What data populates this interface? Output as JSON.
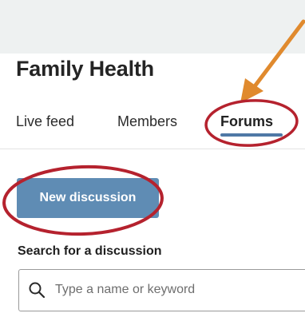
{
  "header": {
    "title": "Family Health"
  },
  "tabs": [
    {
      "label": "Live feed",
      "active": false
    },
    {
      "label": "Members",
      "active": false
    },
    {
      "label": "Forums",
      "active": true
    }
  ],
  "actions": {
    "new_discussion_label": "New discussion"
  },
  "search": {
    "label": "Search for a discussion",
    "placeholder": "Type a name or keyword",
    "value": "",
    "icon": "search-icon"
  },
  "annotations": {
    "arrow_color": "#e08a2e",
    "circle_color": "#b5222e",
    "arrow_icon": "pointer-arrow",
    "circle_icon": "highlight-ellipse"
  },
  "colors": {
    "accent": "#5f8cb4",
    "tab_underline": "#4f78a6",
    "background": "#eef1f1"
  }
}
